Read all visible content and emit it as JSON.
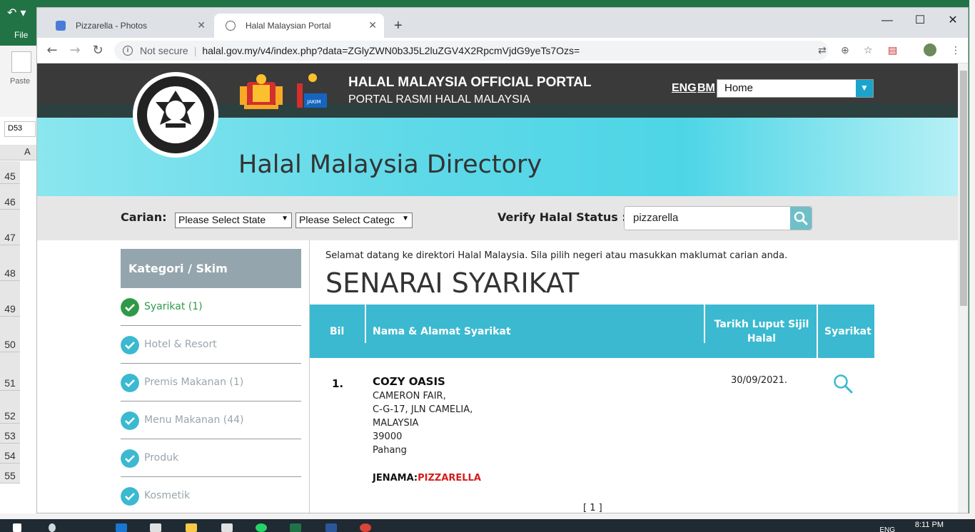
{
  "excel": {
    "file_label": "File",
    "paste_label": "Paste",
    "name_box": "D53",
    "column_a": "A",
    "rows": [
      "45",
      "46",
      "47",
      "48",
      "49",
      "50",
      "51",
      "52",
      "53",
      "54",
      "55"
    ]
  },
  "browser": {
    "tabs": [
      {
        "title": "Pizzarella - Photos"
      },
      {
        "title": "Halal Malaysian Portal"
      }
    ],
    "new_tab": "+",
    "security_label": "Not secure",
    "url": "halal.gov.my/v4/index.php?data=ZGlyZWN0b3J5L2luZGV4X2RpcmVjdG9yeTs7Ozs="
  },
  "header": {
    "title": "HALAL MALAYSIA OFFICIAL PORTAL",
    "subtitle": "PORTAL RASMI HALAL MALAYSIA",
    "lang_eng": "ENG",
    "lang_bm": "BM",
    "nav_select": "Home",
    "jakim_label": "JAKIM"
  },
  "banner": {
    "title": "Halal Malaysia Directory"
  },
  "search": {
    "carian_label": "Carian:",
    "state_select": "Please Select State",
    "category_select": "Please Select Categc",
    "verify_label": "Verify Halal Status :",
    "verify_value": "pizzarella"
  },
  "sidebar": {
    "heading": "Kategori / Skim",
    "items": [
      {
        "label": "Syarikat (1)",
        "active": true
      },
      {
        "label": "Hotel & Resort",
        "active": false
      },
      {
        "label": "Premis Makanan (1)",
        "active": false
      },
      {
        "label": "Menu Makanan (44)",
        "active": false
      },
      {
        "label": "Produk",
        "active": false
      },
      {
        "label": "Kosmetik",
        "active": false
      }
    ]
  },
  "main": {
    "welcome": "Selamat datang ke direktori Halal Malaysia. Sila pilih negeri atau masukkan maklumat carian anda.",
    "heading": "SENARAI SYARIKAT",
    "columns": {
      "bil": "Bil",
      "nama": "Nama & Alamat Syarikat",
      "tarikh_line1": "Tarikh Luput Sijil",
      "tarikh_line2": "Halal",
      "syarikat": "Syarikat"
    },
    "rows": [
      {
        "number": "1.",
        "name": "COZY OASIS",
        "address": [
          "CAMERON FAIR,",
          "C-G-17, JLN CAMELIA,",
          "MALAYSIA",
          "39000",
          "Pahang"
        ],
        "jenama_label": "JENAMA:",
        "jenama_value": "PIZZARELLA",
        "expiry": "30/09/2021."
      }
    ],
    "pager": "[ 1 ]"
  },
  "taskbar": {
    "lang": "ENG",
    "time": "8:11 PM"
  },
  "colors": {
    "accent": "#3bb9d0",
    "active_green": "#2e9a47",
    "inactive_item": "#9aa6ac",
    "brand_red": "#d61c1c"
  }
}
